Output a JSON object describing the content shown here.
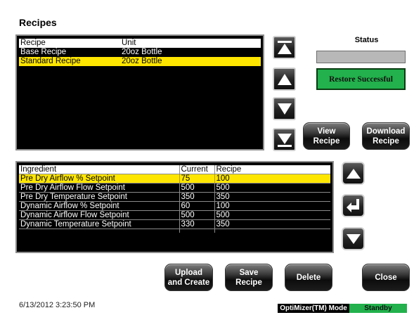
{
  "screen": {
    "title": "Recipes",
    "datetime": "6/13/2012 3:23:50 PM"
  },
  "recipe_list": {
    "headers": {
      "recipe": "Recipe",
      "unit": "Unit"
    },
    "rows": [
      {
        "recipe": "Base Recipe",
        "unit": "20oz Bottle",
        "selected": false
      },
      {
        "recipe": "Standard Recipe",
        "unit": "20oz Bottle",
        "selected": true
      }
    ]
  },
  "status": {
    "label": "Status",
    "message": "Restore Successful",
    "bar_color": "#b8b8b8",
    "message_color": "#22b14c"
  },
  "nav_buttons": {
    "top": "first-page-icon",
    "up": "arrow-up-icon",
    "down": "arrow-down-icon",
    "bottom": "last-page-icon"
  },
  "recipe_actions": {
    "view": [
      "View",
      "Recipe"
    ],
    "download": [
      "Download",
      "Recipe"
    ]
  },
  "ingredients": {
    "headers": {
      "ingredient": "Ingredient",
      "current": "Current",
      "recipe": "Recipe"
    },
    "rows": [
      {
        "ingredient": "Pre Dry Airflow % Setpoint",
        "current": "75",
        "recipe": "100",
        "selected": true
      },
      {
        "ingredient": "Pre Dry Airflow Flow Setpoint",
        "current": "500",
        "recipe": "500",
        "selected": false
      },
      {
        "ingredient": "Pre Dry Temperature Setpoint",
        "current": "350",
        "recipe": "350",
        "selected": false
      },
      {
        "ingredient": "Dynamic Airflow % Setpoint",
        "current": "60",
        "recipe": "100",
        "selected": false
      },
      {
        "ingredient": "Dynamic Airflow Flow Setpoint",
        "current": "500",
        "recipe": "500",
        "selected": false
      },
      {
        "ingredient": "Dynamic Temperature Setpoint",
        "current": "330",
        "recipe": "350",
        "selected": false
      },
      {
        "ingredient": "",
        "current": "",
        "recipe": "",
        "selected": false
      }
    ]
  },
  "ingredient_nav": {
    "up": "arrow-up-icon",
    "enter": "enter-icon",
    "down": "arrow-down-icon"
  },
  "bottom_actions": {
    "upload": [
      "Upload",
      "and Create"
    ],
    "save": [
      "Save",
      "Recipe"
    ],
    "delete": "Delete",
    "close": "Close"
  },
  "mode": {
    "label": "OptiMizer(TM) Mode",
    "state": "Standby",
    "state_color": "#22b14c"
  },
  "colors": {
    "highlight": "#ffe600",
    "panel_bg": "#000000",
    "accent_green": "#22b14c"
  }
}
